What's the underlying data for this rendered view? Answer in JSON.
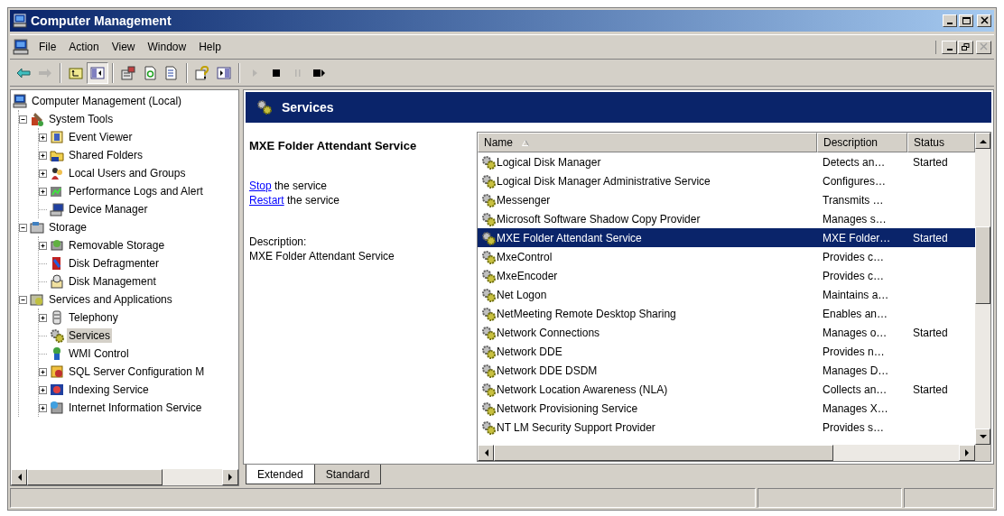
{
  "window": {
    "title": "Computer Management",
    "controls": [
      {
        "disabled": false
      },
      {
        "disabled": false
      },
      {
        "disabled": false
      }
    ]
  },
  "menu": {
    "items": [
      "File",
      "Action",
      "View",
      "Window",
      "Help"
    ],
    "mdi_controls": [
      {
        "disabled": false
      },
      {
        "disabled": false
      },
      {
        "disabled": true
      }
    ]
  },
  "toolbar": [
    [
      {
        "disabled": false,
        "pressed": false
      },
      {
        "disabled": true,
        "pressed": false
      }
    ],
    [
      {
        "disabled": false,
        "pressed": false
      },
      {
        "disabled": false,
        "pressed": true
      }
    ],
    [
      {
        "disabled": false,
        "pressed": false
      },
      {
        "disabled": false,
        "pressed": false
      },
      {
        "disabled": false,
        "pressed": false
      }
    ],
    [
      {
        "disabled": false,
        "pressed": false
      },
      {
        "disabled": false,
        "pressed": false
      }
    ],
    [
      {
        "disabled": true,
        "pressed": false
      },
      {
        "disabled": false,
        "pressed": false
      },
      {
        "disabled": true,
        "pressed": false
      },
      {
        "disabled": false,
        "pressed": false
      }
    ]
  ],
  "tree": [
    {
      "label": "Computer Management (Local)",
      "kind": "root",
      "selected": false,
      "children": [
        {
          "label": "System Tools",
          "kind": "node",
          "expanded": true,
          "selected": false,
          "children": [
            {
              "label": "Event Viewer",
              "kind": "node",
              "expanded": false,
              "selected": false
            },
            {
              "label": "Shared Folders",
              "kind": "node",
              "expanded": false,
              "selected": false
            },
            {
              "label": "Local Users and Groups",
              "kind": "node",
              "expanded": false,
              "selected": false
            },
            {
              "label": "Performance Logs and Alert",
              "kind": "node",
              "expanded": false,
              "selected": false
            },
            {
              "label": "Device Manager",
              "kind": "leaf",
              "selected": false
            }
          ]
        },
        {
          "label": "Storage",
          "kind": "node",
          "expanded": true,
          "selected": false,
          "children": [
            {
              "label": "Removable Storage",
              "kind": "node",
              "expanded": false,
              "selected": false
            },
            {
              "label": "Disk Defragmenter",
              "kind": "leaf",
              "selected": false
            },
            {
              "label": "Disk Management",
              "kind": "leaf",
              "selected": false
            }
          ]
        },
        {
          "label": "Services and Applications",
          "kind": "node",
          "expanded": true,
          "selected": false,
          "children": [
            {
              "label": "Telephony",
              "kind": "node",
              "expanded": false,
              "selected": false
            },
            {
              "label": "Services",
              "kind": "leaf",
              "selected": true
            },
            {
              "label": "WMI Control",
              "kind": "leaf",
              "selected": false
            },
            {
              "label": "SQL Server Configuration M",
              "kind": "node",
              "expanded": false,
              "selected": false
            },
            {
              "label": "Indexing Service",
              "kind": "node",
              "expanded": false,
              "selected": false
            },
            {
              "label": "Internet Information Service",
              "kind": "node",
              "expanded": false,
              "selected": false
            }
          ]
        }
      ]
    }
  ],
  "pane": {
    "title": "Services",
    "details": {
      "title": "MXE Folder Attendant Service",
      "actions": [
        {
          "link": "Stop",
          "text": "the service"
        },
        {
          "link": "Restart",
          "text": "the service"
        }
      ],
      "description_label": "Description:",
      "description": "MXE Folder Attendant Service"
    },
    "table": {
      "columns": [
        {
          "label": "Name",
          "sorted": true
        },
        {
          "label": "Description",
          "sorted": false
        },
        {
          "label": "Status",
          "sorted": false
        }
      ],
      "rows": [
        {
          "name": "Logical Disk Manager",
          "description": "Detects an…",
          "status": "Started",
          "selected": false
        },
        {
          "name": "Logical Disk Manager Administrative Service",
          "description": "Configures…",
          "selected": false
        },
        {
          "name": "Messenger",
          "description": "Transmits …",
          "selected": false
        },
        {
          "name": "Microsoft Software Shadow Copy Provider",
          "description": "Manages s…",
          "selected": false
        },
        {
          "name": "MXE Folder Attendant Service",
          "description": "MXE Folder…",
          "status": "Started",
          "selected": true
        },
        {
          "name": "MxeControl",
          "description": "Provides c…",
          "selected": false
        },
        {
          "name": "MxeEncoder",
          "description": "Provides c…",
          "selected": false
        },
        {
          "name": "Net Logon",
          "description": "Maintains a…",
          "selected": false
        },
        {
          "name": "NetMeeting Remote Desktop Sharing",
          "description": "Enables an…",
          "selected": false
        },
        {
          "name": "Network Connections",
          "description": "Manages o…",
          "status": "Started",
          "selected": false
        },
        {
          "name": "Network DDE",
          "description": "Provides n…",
          "selected": false
        },
        {
          "name": "Network DDE DSDM",
          "description": "Manages D…",
          "selected": false
        },
        {
          "name": "Network Location Awareness (NLA)",
          "description": "Collects an…",
          "status": "Started",
          "selected": false
        },
        {
          "name": "Network Provisioning Service",
          "description": "Manages X…",
          "selected": false
        },
        {
          "name": "NT LM Security Support Provider",
          "description": "Provides s…",
          "selected": false
        }
      ]
    },
    "tabs": [
      {
        "label": "Extended",
        "selected": true
      },
      {
        "label": "Standard",
        "selected": false
      }
    ]
  }
}
